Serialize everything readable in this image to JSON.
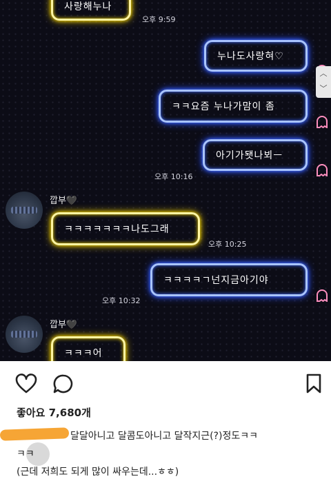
{
  "chat": {
    "messages": [
      {
        "side": "left",
        "text": "사랑해누나",
        "time": "오후 9:59"
      },
      {
        "side": "right",
        "text": "누나도사랑혀♡"
      },
      {
        "side": "right",
        "text": "ㅋㅋ요즘 누나가맘이 좀"
      },
      {
        "side": "right",
        "text": "아기가됏나뵈ㅡ",
        "time": "오후 10:16"
      },
      {
        "side": "left",
        "sender": "깝부🖤",
        "text": "ㅋㅋㅋㅋㅋㅋㅋ나도그래",
        "time": "오후 10:25"
      },
      {
        "side": "right",
        "text": "ㅋㅋㅋㅋㄱ넌지금아기야",
        "time": "오후 10:32"
      },
      {
        "side": "left",
        "sender": "깝부🖤",
        "text": "ㅋㅋㅋ어"
      }
    ],
    "scroll_up": "︿",
    "scroll_down": "﹀"
  },
  "post": {
    "likes_label": "좋아요 7,680개",
    "caption_line1": "달달아니고 달콤도아니고 달작지근(?)정도ㅋㅋ",
    "caption_line2": "ㅋㅋ",
    "caption_line3": "(근데 저희도 되게 많이 싸우는데...ㅎㅎ)"
  },
  "colors": {
    "blue_neon": "#3f6cff",
    "yellow_neon": "#f0d400",
    "ghost_pink": "#ff8fbf",
    "highlight": "#f6a02a"
  }
}
